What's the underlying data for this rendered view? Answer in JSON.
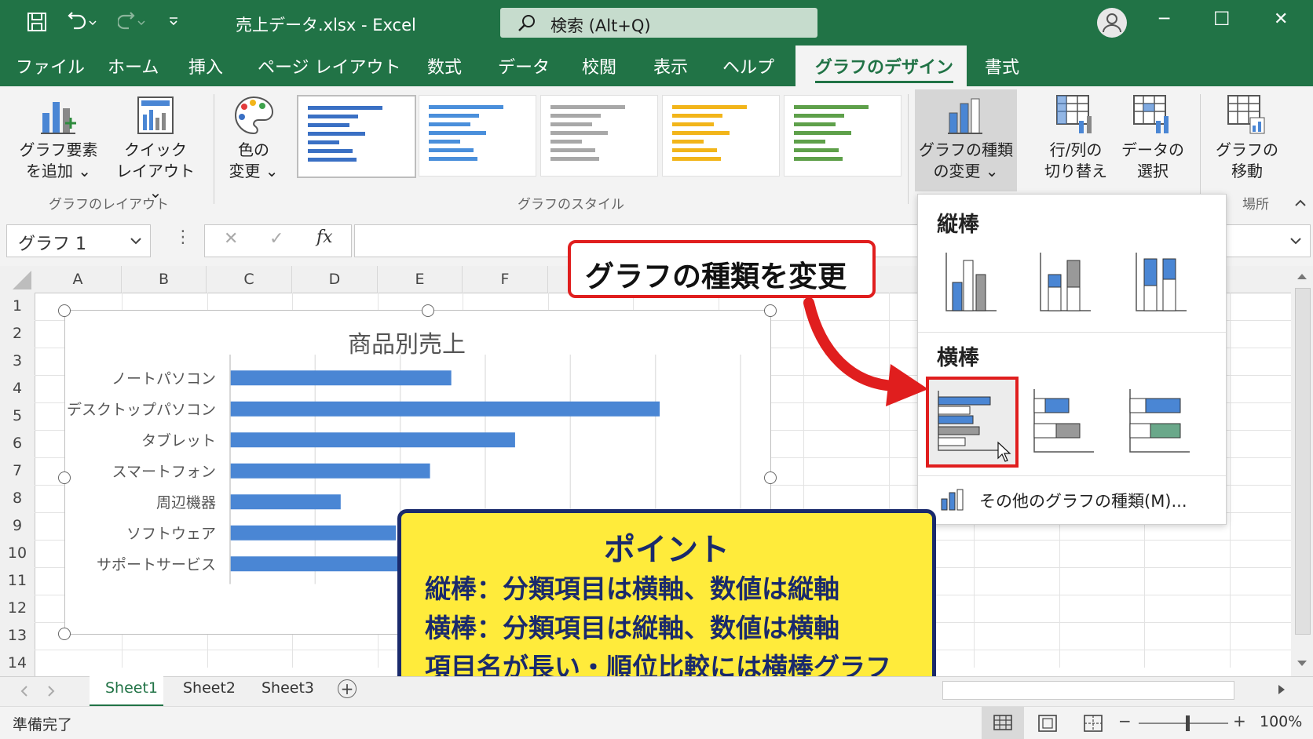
{
  "title_bar": {
    "file_title": "売上データ.xlsx  -  Excel",
    "search_placeholder": "検索 (Alt+Q)",
    "window_minimize": "─",
    "window_maximize": "☐",
    "window_close": "✕"
  },
  "menu": {
    "items": [
      "ファイル",
      "ホーム",
      "挿入",
      "ページ レイアウト",
      "数式",
      "データ",
      "校閲",
      "表示",
      "ヘルプ",
      "グラフのデザイン",
      "書式"
    ],
    "active": "グラフのデザイン"
  },
  "ribbon": {
    "add_element": [
      "グラフ要素",
      "を追加 ⌄"
    ],
    "quick_layout": [
      "クイック",
      "レイアウト ⌄"
    ],
    "change_colors": [
      "色の",
      "変更 ⌄"
    ],
    "change_type": [
      "グラフの種類",
      "の変更 ⌄"
    ],
    "switch_row_col": [
      "行/列の",
      "切り替え"
    ],
    "select_data": [
      "データの",
      "選択"
    ],
    "move_chart": [
      "グラフの",
      "移動"
    ],
    "group_layout": "グラフのレイアウト",
    "group_style": "グラフのスタイル",
    "group_location": "場所",
    "style_colors": [
      "#3a70c4",
      "#4a8fdb",
      "#a8a8a8",
      "#f2b51a",
      "#5ea04a"
    ]
  },
  "formula_bar": {
    "name_box": "グラフ 1",
    "cancel": "✕",
    "enter": "✓",
    "fx": "fx",
    "value": ""
  },
  "grid": {
    "columns": [
      "A",
      "B",
      "C",
      "D",
      "E",
      "F"
    ],
    "rows": [
      "1",
      "2",
      "3",
      "4",
      "5",
      "6",
      "7",
      "8",
      "9",
      "10",
      "11",
      "12",
      "13",
      "14"
    ]
  },
  "chart_data": {
    "type": "bar",
    "orientation": "horizontal",
    "title": "商品別売上",
    "categories": [
      "ノートパソコン",
      "デスクトップパソコン",
      "タブレット",
      "スマートフォン",
      "周辺機器",
      "ソフトウェア",
      "サポートサービス"
    ],
    "values": [
      2.6,
      5.05,
      3.35,
      2.35,
      1.3,
      1.95,
      2.0
    ],
    "xlim": [
      0,
      6
    ],
    "grid": true,
    "color": "#4a86d4"
  },
  "dropdown": {
    "section_vertical": "縦棒",
    "section_horizontal": "横棒",
    "more_types": "その他のグラフの種類(M)..."
  },
  "callouts": {
    "red": "グラフの種類を変更",
    "point_title": "ポイント",
    "point_lines": [
      "縦棒：分類項目は横軸、数値は縦軸",
      "横棒：分類項目は縦軸、数値は横軸",
      "項目名が長い・順位比較には横棒グラフ"
    ]
  },
  "sheets": {
    "tabs": [
      "Sheet1",
      "Sheet2",
      "Sheet3"
    ],
    "active": "Sheet1",
    "add": "+"
  },
  "status": {
    "text": "準備完了",
    "zoom": "100%"
  }
}
